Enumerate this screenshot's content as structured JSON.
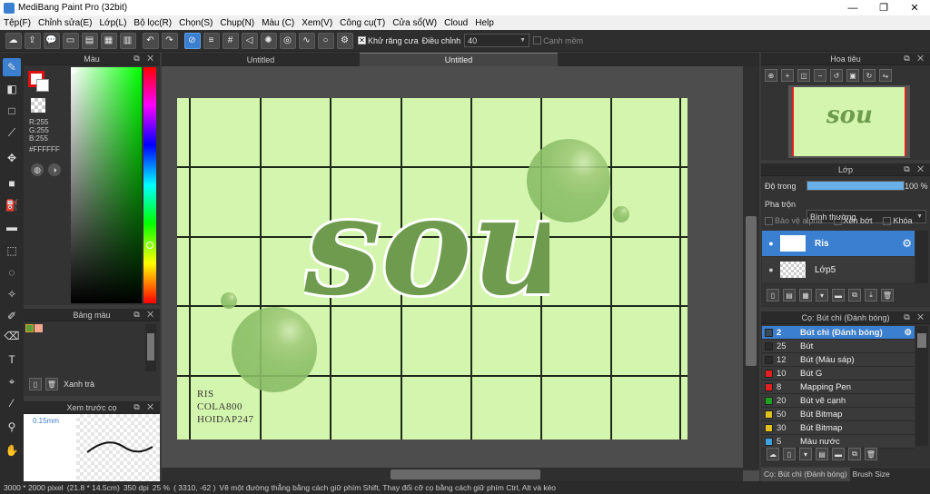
{
  "window": {
    "title": "MediBang Paint Pro (32bit)",
    "minimize": "—",
    "maximize": "❐",
    "close": "✕"
  },
  "menu": [
    "Tệp(F)",
    "Chỉnh sửa(E)",
    "Lớp(L)",
    "Bộ lọc(R)",
    "Chọn(S)",
    "Chụp(N)",
    "Màu (C)",
    "Xem(V)",
    "Công cụ(T)",
    "Cửa sổ(W)",
    "Cloud",
    "Help"
  ],
  "toolbar": {
    "antialias_label": "Khử răng cưa",
    "antialias_checked": true,
    "adjust_label": "Điều chỉnh",
    "adjust_value": "40",
    "edge_label": "Cạnh mềm",
    "edge_checked": false
  },
  "color_panel": {
    "title": "Màu",
    "rgb": {
      "r": "R:255",
      "g": "G:255",
      "b": "B:255"
    },
    "hex": "#FFFFFF",
    "primary_color": "#ffffff",
    "secondary_outline": "#e01010"
  },
  "palette_panel": {
    "title": "Bảng màu",
    "swatches": [
      "#5aa03c",
      "#f4a890"
    ],
    "palette_name": "Xanh trà"
  },
  "brush_preview": {
    "title": "Xem trước cọ",
    "size": "0.15mm"
  },
  "tabs": [
    "Untitled",
    "Untitled"
  ],
  "artwork": {
    "bg_color": "#d4f5ad",
    "word": "sou",
    "word_color": "#6e9b4d",
    "signature": [
      "RIS",
      "COLA800",
      "HOIDAP247"
    ]
  },
  "navigator": {
    "title": "Hoa tiêu"
  },
  "layers": {
    "title": "Lớp",
    "opacity_label": "Độ trong",
    "opacity_value": "100 %",
    "opacity_fraction": 1.0,
    "blend_label": "Pha trộn",
    "blend_value": "Bình thường",
    "protect_alpha": "Bảo vệ alpha",
    "clipping": "Xén bớt",
    "lock": "Khóa",
    "items": [
      {
        "name": "Ris",
        "selected": true
      },
      {
        "name": "Lớp5",
        "selected": false
      }
    ]
  },
  "brush_panel": {
    "title": "Cọ: Bút chì (Đánh bóng)",
    "items": [
      {
        "num": "2",
        "name": "Bút chì (Đánh bóng)",
        "color": "#3b4a5a",
        "selected": true
      },
      {
        "num": "25",
        "name": "Bút",
        "color": "#2a2a2a",
        "selected": false
      },
      {
        "num": "12",
        "name": "Bút (Màu sáp)",
        "color": "#2a2a2a",
        "selected": false
      },
      {
        "num": "10",
        "name": "Bút G",
        "color": "#e02020",
        "selected": false
      },
      {
        "num": "8",
        "name": "Mapping Pen",
        "color": "#e02020",
        "selected": false
      },
      {
        "num": "20",
        "name": "Bút vẽ cạnh",
        "color": "#20a020",
        "selected": false
      },
      {
        "num": "50",
        "name": "Bút Bitmap",
        "color": "#e0c020",
        "selected": false
      },
      {
        "num": "30",
        "name": "Bút Bitmap",
        "color": "#e0c020",
        "selected": false
      },
      {
        "num": "5",
        "name": "Màu nước",
        "color": "#40a0e0",
        "selected": false
      }
    ]
  },
  "bottom_tabs": [
    "Cọ: Bút chì (Đánh bóng)",
    "Brush Size"
  ],
  "status": {
    "size": "3000 * 2000 pixel",
    "physical": "(21.8 * 14.5cm)",
    "dpi": "350 dpi",
    "zoom": "25 %",
    "coords": "( 3310, -62 )",
    "hint": "Vẽ một đường thẳng bằng cách giữ phím Shift, Thay đổi cỡ cọ bằng cách giữ phím Ctrl, Alt và kéo"
  }
}
